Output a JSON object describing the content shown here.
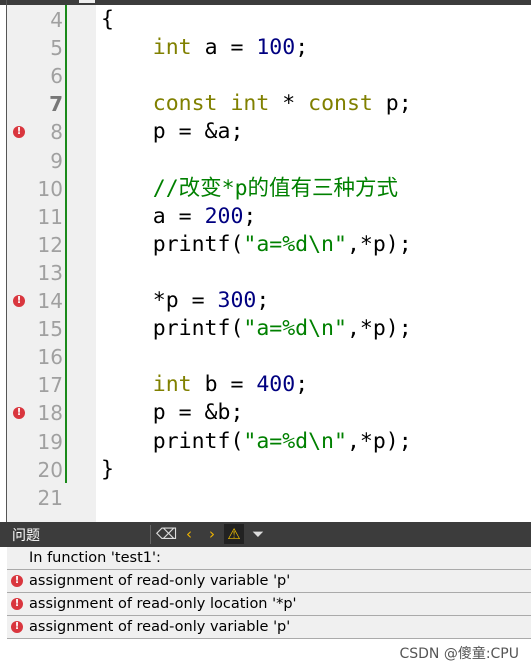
{
  "editor": {
    "lines": [
      {
        "n": "4",
        "tokens": [
          [
            "",
            "{"
          ]
        ]
      },
      {
        "n": "5",
        "tokens": [
          [
            "",
            "    "
          ],
          [
            "kw",
            "int"
          ],
          [
            "",
            " a = "
          ],
          [
            "num",
            "100"
          ],
          [
            "",
            ";"
          ]
        ]
      },
      {
        "n": "6",
        "tokens": []
      },
      {
        "n": "7",
        "bold": true,
        "tokens": [
          [
            "",
            "    "
          ],
          [
            "kw",
            "const int"
          ],
          [
            "",
            " * "
          ],
          [
            "kw",
            "const"
          ],
          [
            "",
            " p;"
          ]
        ]
      },
      {
        "n": "8",
        "error": true,
        "tokens": [
          [
            "",
            "    p = &a;"
          ]
        ]
      },
      {
        "n": "9",
        "tokens": []
      },
      {
        "n": "10",
        "tokens": [
          [
            "",
            "    "
          ],
          [
            "cm",
            "//改变*p的值有三种方式"
          ]
        ]
      },
      {
        "n": "11",
        "tokens": [
          [
            "",
            "    a = "
          ],
          [
            "num",
            "200"
          ],
          [
            "",
            ";"
          ]
        ]
      },
      {
        "n": "12",
        "tokens": [
          [
            "",
            "    printf("
          ],
          [
            "str",
            "\"a=%d\\n\""
          ],
          [
            "",
            ",*p);"
          ]
        ]
      },
      {
        "n": "13",
        "tokens": []
      },
      {
        "n": "14",
        "error": true,
        "tokens": [
          [
            "",
            "    *p = "
          ],
          [
            "num",
            "300"
          ],
          [
            "",
            ";"
          ]
        ]
      },
      {
        "n": "15",
        "tokens": [
          [
            "",
            "    printf("
          ],
          [
            "str",
            "\"a=%d\\n\""
          ],
          [
            "",
            ",*p);"
          ]
        ]
      },
      {
        "n": "16",
        "tokens": []
      },
      {
        "n": "17",
        "tokens": [
          [
            "",
            "    "
          ],
          [
            "kw",
            "int"
          ],
          [
            "",
            " b = "
          ],
          [
            "num",
            "400"
          ],
          [
            "",
            ";"
          ]
        ]
      },
      {
        "n": "18",
        "error": true,
        "tokens": [
          [
            "",
            "    p = &b;"
          ]
        ]
      },
      {
        "n": "19",
        "tokens": [
          [
            "",
            "    printf("
          ],
          [
            "str",
            "\"a=%d\\n\""
          ],
          [
            "",
            ",*p);"
          ]
        ]
      },
      {
        "n": "20",
        "tokens": [
          [
            "",
            "}"
          ]
        ]
      },
      {
        "n": "21",
        "tokens": []
      }
    ]
  },
  "problems": {
    "title": "问题",
    "context": "In function 'test1':",
    "items": [
      "assignment of read-only variable 'p'",
      "assignment of read-only location '*p'",
      "assignment of read-only variable 'p'"
    ]
  },
  "watermark": "CSDN @傻童:CPU"
}
